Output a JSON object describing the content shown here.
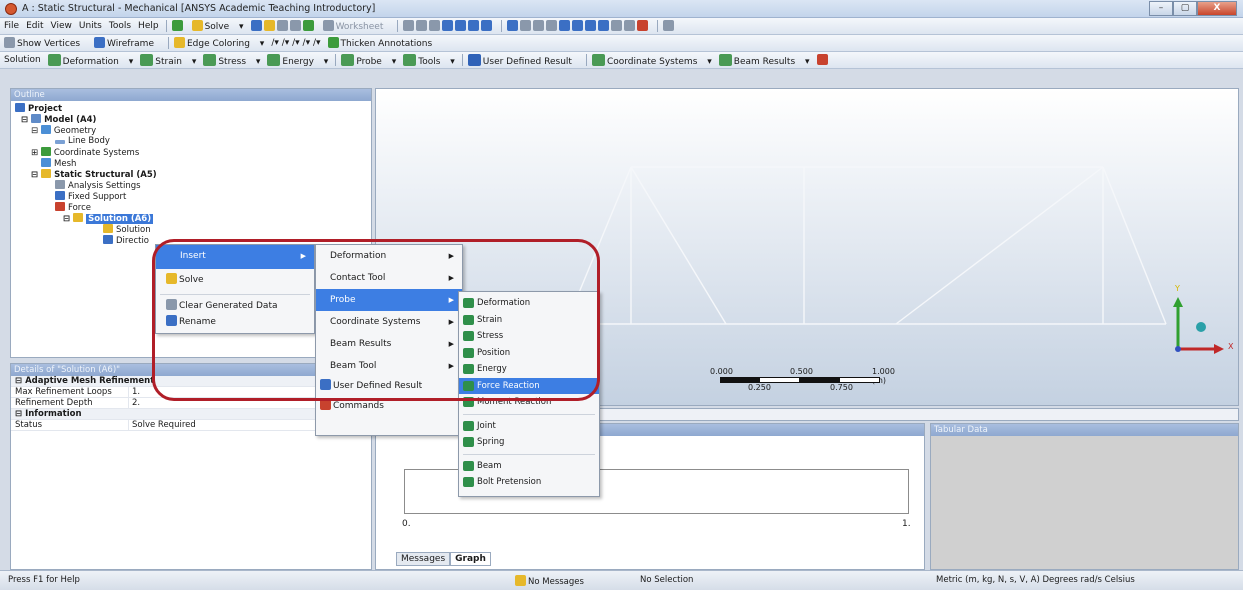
{
  "window": {
    "title": "A : Static Structural - Mechanical [ANSYS Academic Teaching Introductory]",
    "buttons": [
      "–",
      "▢",
      "X"
    ]
  },
  "menubar": {
    "items": [
      "File",
      "Edit",
      "View",
      "Units",
      "Tools",
      "Help"
    ],
    "solve_label": "Solve",
    "worksheet_label": "Worksheet"
  },
  "toolbar2": {
    "show_vertices": "Show Vertices",
    "wireframe": "Wireframe",
    "edge_coloring": "Edge Coloring",
    "thicken_annotations": "Thicken Annotations"
  },
  "toolbar3": {
    "solution": "Solution",
    "deformation": "Deformation",
    "strain": "Strain",
    "stress": "Stress",
    "energy": "Energy",
    "probe": "Probe",
    "tools": "Tools",
    "user_defined_result": "User Defined Result",
    "coordinate_systems": "Coordinate Systems",
    "beam_results": "Beam Results"
  },
  "outline": {
    "header": "Outline",
    "tree": {
      "project": "Project",
      "model": "Model (A4)",
      "geometry": "Geometry",
      "line_body": "Line Body",
      "coordinate_systems": "Coordinate Systems",
      "mesh": "Mesh",
      "static_structural": "Static Structural (A5)",
      "analysis_settings": "Analysis Settings",
      "fixed_support": "Fixed Support",
      "force": "Force",
      "solution": "Solution (A6)",
      "solution_info": "Solution",
      "directional": "Directio"
    }
  },
  "details": {
    "header": "Details of \"Solution (A6)\"",
    "sections": [
      {
        "title": "Adaptive Mesh Refinement",
        "rows": [
          {
            "key": "Max Refinement Loops",
            "value": "1."
          },
          {
            "key": "Refinement Depth",
            "value": "2."
          }
        ]
      },
      {
        "title": "Information",
        "rows": [
          {
            "key": "Status",
            "value": "Solve Required"
          }
        ]
      }
    ]
  },
  "context_menu": {
    "items": [
      "Insert",
      "Solve",
      "Clear Generated Data",
      "Rename"
    ]
  },
  "insert_submenu": {
    "items": [
      "Deformation",
      "Contact Tool",
      "Probe",
      "Coordinate Systems",
      "Beam Results",
      "Beam Tool",
      "User Defined Result",
      "Commands"
    ]
  },
  "probe_submenu": {
    "items": [
      "Deformation",
      "Strain",
      "Stress",
      "Position",
      "Energy",
      "Force Reaction",
      "Moment Reaction",
      "Joint",
      "Spring",
      "Beam",
      "Bolt Pretension"
    ]
  },
  "viewport": {
    "scale": {
      "ticks_top": [
        "0.000",
        "0.500",
        "1.000 (m)"
      ],
      "ticks_bottom": [
        "0.250",
        "0.750"
      ]
    },
    "axis_labels": {
      "y": "Y",
      "x": "X"
    }
  },
  "graph": {
    "header": "Graph",
    "x_start": "0.",
    "x_end": "1.",
    "tabs": [
      "Messages",
      "Graph"
    ]
  },
  "tabular": {
    "header": "Tabular Data"
  },
  "status": {
    "help": "Press F1 for Help",
    "messages": "No Messages",
    "selection": "No Selection",
    "units": "Metric (m, kg, N, s, V, A)  Degrees  rad/s  Celsius"
  },
  "colors": {
    "accent": "#3d7ee3",
    "highlight_ring": "#b01e28"
  }
}
